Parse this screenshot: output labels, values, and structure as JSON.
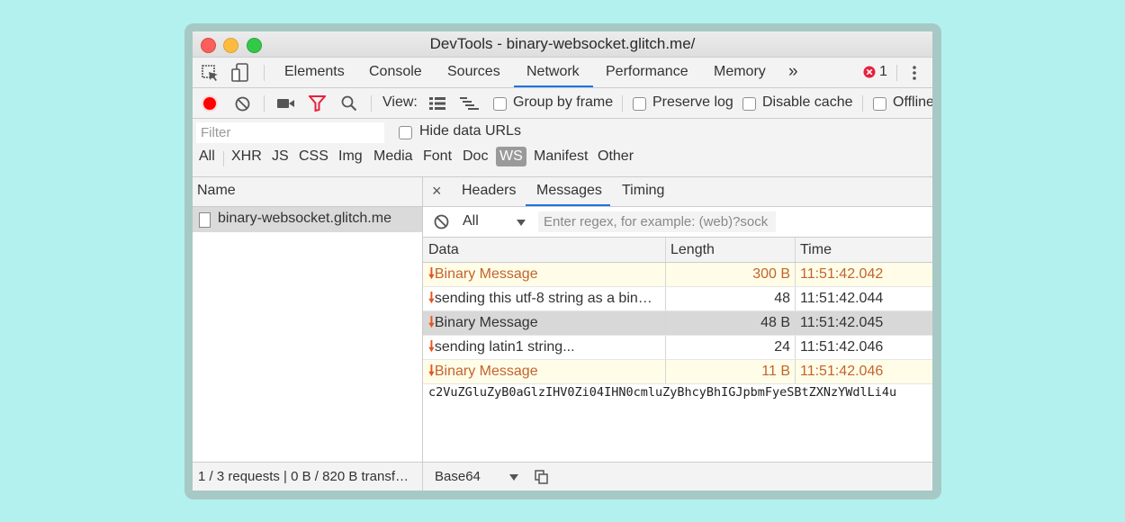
{
  "window": {
    "title": "DevTools - binary-websocket.glitch.me/"
  },
  "tabs": [
    "Elements",
    "Console",
    "Sources",
    "Network",
    "Performance",
    "Memory"
  ],
  "active_tab": "Network",
  "tabs_overflow": "»",
  "error_count": "1",
  "toolbar": {
    "view_label": "View:",
    "group_by_frame": "Group by frame",
    "preserve_log": "Preserve log",
    "disable_cache": "Disable cache",
    "offline": "Offline"
  },
  "filter": {
    "placeholder": "Filter",
    "hide_data_urls": "Hide data URLs",
    "types": [
      "All",
      "XHR",
      "JS",
      "CSS",
      "Img",
      "Media",
      "Font",
      "Doc",
      "WS",
      "Manifest",
      "Other"
    ],
    "active_type": "WS"
  },
  "requests": {
    "header": "Name",
    "rows": [
      "binary-websocket.glitch.me"
    ]
  },
  "detail": {
    "close": "×",
    "tabs": [
      "Headers",
      "Messages",
      "Timing"
    ],
    "active_tab": "Messages",
    "message_filter_select": "All",
    "regex_placeholder": "Enter regex, for example: (web)?sock"
  },
  "messages": {
    "columns": [
      "Data",
      "Length",
      "Time"
    ],
    "rows": [
      {
        "data": "Binary Message",
        "length": "300 B",
        "time": "11:51:42.042"
      },
      {
        "data": "sending this utf-8 string as a bin…",
        "length": "48",
        "time": "11:51:42.044"
      },
      {
        "data": "Binary Message",
        "length": "48 B",
        "time": "11:51:42.045"
      },
      {
        "data": "sending latin1 string...",
        "length": "24",
        "time": "11:51:42.046"
      },
      {
        "data": "Binary Message",
        "length": "11 B",
        "time": "11:51:42.046"
      }
    ],
    "payload": "c2VuZGluZyB0aGlzIHV0Zi04IHN0cmluZyBhcyBhIGJpbmFyeSBtZXNzYWdlLi4u"
  },
  "status": {
    "summary": "1 / 3 requests | 0 B / 820 B transf…",
    "encoding": "Base64"
  },
  "colors": {
    "accent": "#1a73e8",
    "record": "#ff0000",
    "filter_active": "#e8213b",
    "binary_text": "#c4632c",
    "arrow": "#e8531d"
  }
}
